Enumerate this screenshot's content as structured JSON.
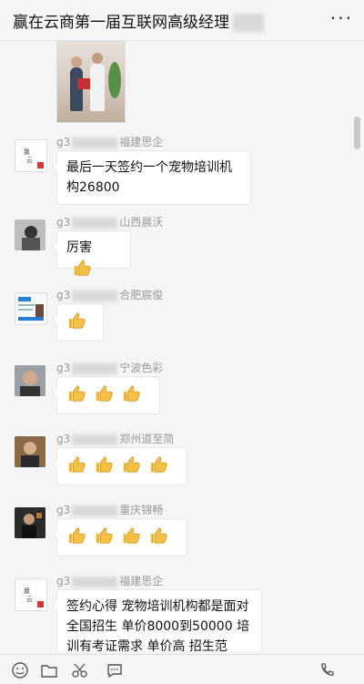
{
  "header": {
    "title": "赢在云商第一届互联网高级经理",
    "more_icon": "more-icon"
  },
  "messages": [
    {
      "sender_prefix": "g3",
      "sender_suffix": "福建思企",
      "avatar": "logo-avatar",
      "text": "最后一天签约一个宠物培训机构26800"
    },
    {
      "sender_prefix": "g3",
      "sender_suffix": "山西晨沃",
      "avatar": "person-avatar",
      "text": "厉害",
      "thumbs": 1
    },
    {
      "sender_prefix": "g3",
      "sender_suffix": "合肥宸俊",
      "avatar": "card-avatar",
      "thumbs": 1
    },
    {
      "sender_prefix": "g3",
      "sender_suffix": "宁波色彩",
      "avatar": "person-avatar",
      "thumbs": 3
    },
    {
      "sender_prefix": "g3",
      "sender_suffix": "郑州道至简",
      "avatar": "person-avatar",
      "thumbs": 4
    },
    {
      "sender_prefix": "g3",
      "sender_suffix": "重庆锦畅",
      "avatar": "person-avatar",
      "thumbs": 4
    },
    {
      "sender_prefix": "g3",
      "sender_suffix": "福建思企",
      "avatar": "logo-avatar",
      "text": "签约心得  宠物培训机构都是面对全国招生 单价8000到50000 培训有考证需求 单价高 招生范"
    }
  ],
  "toolbar": {
    "icons": [
      "emoji-icon",
      "folder-icon",
      "scissors-icon",
      "chat-bubble-icon",
      "phone-icon"
    ]
  }
}
